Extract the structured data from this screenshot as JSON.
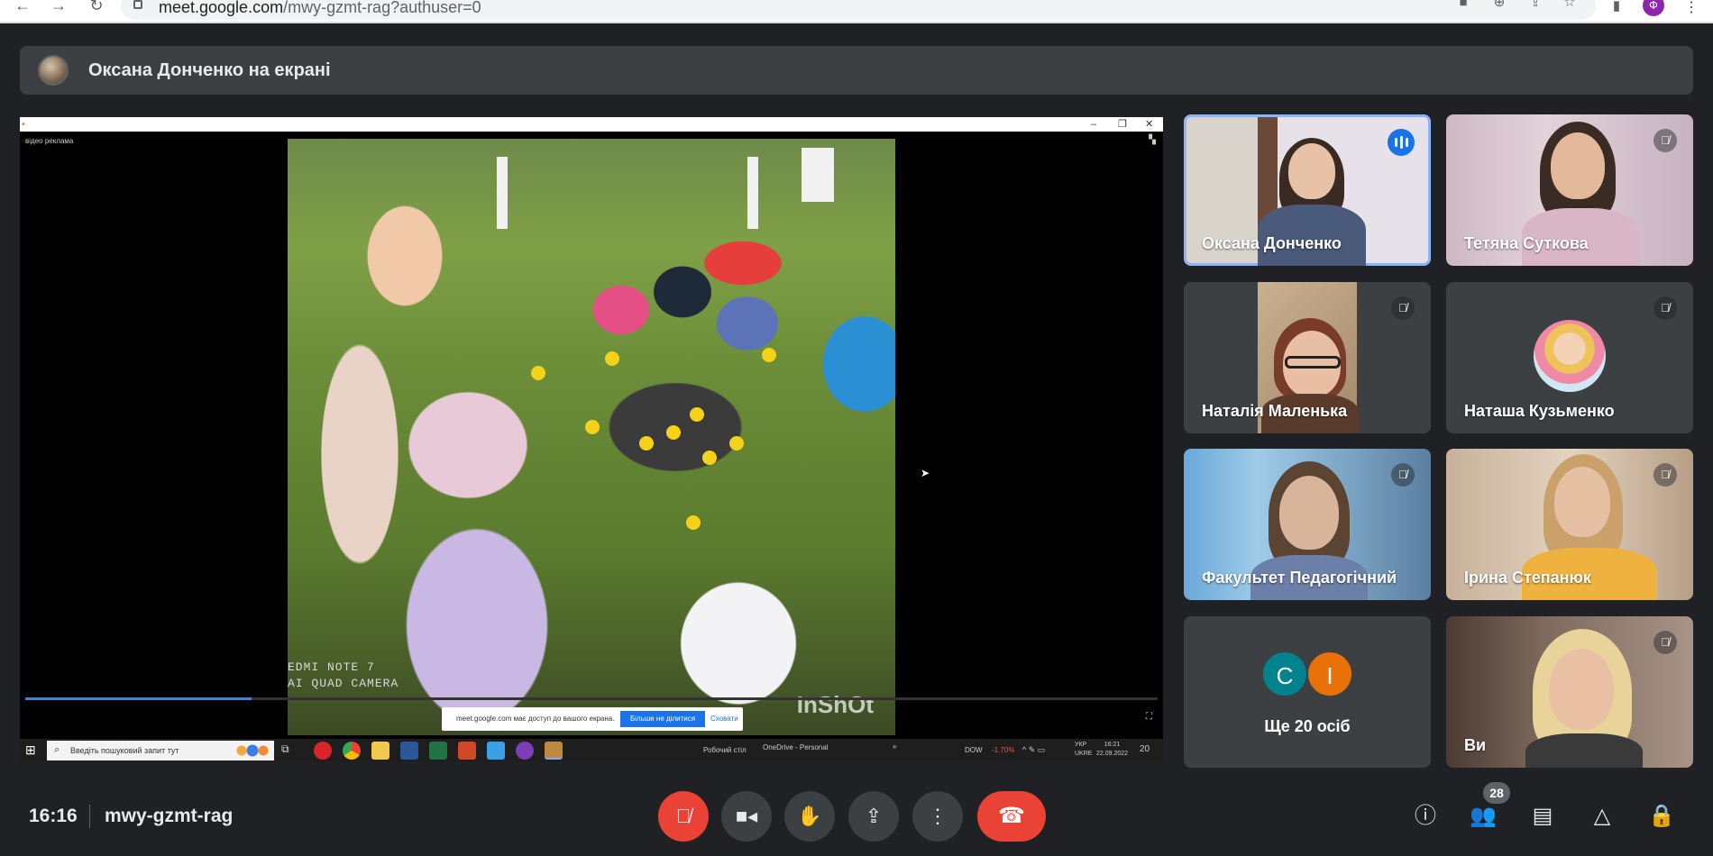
{
  "browser": {
    "url_domain": "meet.google.com",
    "url_path": "/mwy-gzmt-rag?authuser=0",
    "profile_initial": "Ф"
  },
  "presenter": {
    "text": "Оксана Донченко на екрані"
  },
  "shared_screen": {
    "app_label": "відео реклама",
    "video_overlay_line1": "EDMI NOTE 7",
    "video_overlay_line2": "AI QUAD CAMERA",
    "video_watermark": "InShOt",
    "progress_fraction": 0.2,
    "share_notice": {
      "text": "meet.google.com має доступ до вашого екрана.",
      "stop_button": "Більше не ділитися",
      "hide_button": "Сховати"
    },
    "taskbar": {
      "search_placeholder": "Введіть пошуковий запит тут",
      "desktop_label": "Робочий стіл",
      "onedrive_label": "OneDrive - Personal",
      "stock_label": "DOW",
      "stock_value": "-1.70%",
      "lang_line1": "УКР",
      "lang_line2": "UKRE",
      "time": "16:21",
      "date": "22.09.2022",
      "notif_count": "20"
    }
  },
  "participants": [
    {
      "name": "Оксана Донченко",
      "state": "speaking"
    },
    {
      "name": "Тетяна Суткова",
      "state": "muted"
    },
    {
      "name": "Наталія Маленька",
      "state": "muted"
    },
    {
      "name": "Наташа Кузьменко",
      "state": "muted"
    },
    {
      "name": "Факультет Педагогічний",
      "state": "muted"
    },
    {
      "name": "Ірина Степанюк",
      "state": "muted"
    },
    {
      "name": "Ви",
      "state": "muted"
    }
  ],
  "more_tile": {
    "initial_1": "C",
    "initial_2": "I",
    "label": "Ще 20 осіб"
  },
  "bottom_bar": {
    "time": "16:16",
    "meeting_code": "mwy-gzmt-rag",
    "participants_badge": "28"
  },
  "colors": {
    "background": "#202124",
    "tile": "#3c4043",
    "accent": "#8ab4f8",
    "speaking": "#1a73e8",
    "danger": "#ea4335",
    "avatar_c": "#00838f",
    "avatar_i": "#e8710a"
  },
  "icons": {
    "mute": "mic-off-icon",
    "camera": "videocam-icon",
    "hand": "raise-hand-icon",
    "present": "present-screen-icon",
    "more": "more-vert-icon",
    "hangup": "call-end-icon",
    "info": "info-icon",
    "people": "people-icon",
    "chat": "chat-icon",
    "activities": "activities-icon",
    "host": "host-controls-icon"
  }
}
